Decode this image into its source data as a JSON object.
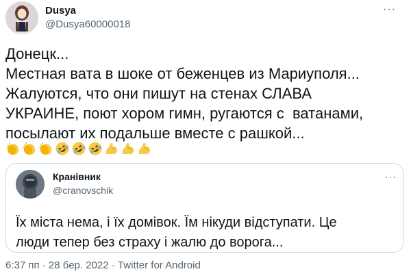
{
  "tweet": {
    "author": {
      "name": "Dusya",
      "handle": "@Dusya60000018",
      "avatar_icon": "doll-avatar"
    },
    "more_label": "···",
    "text": "Донецк...\nМестная вата в шоке от беженцев из Мариуполя...\nЖалуются, что они пишут на стенах СЛАВА\nУКРАИНЕ, поют хором гимн, ругаются с  ватанами,\nпосылают их подальше вместе с рашкой...",
    "emojis": [
      "clapping-hands",
      "clapping-hands",
      "clapping-hands",
      "rolling-laughing",
      "rolling-laughing",
      "rolling-laughing",
      "flexed-biceps",
      "flexed-biceps",
      "flexed-biceps"
    ],
    "quoted": {
      "name": "Кранівник",
      "handle": "@cranovschik",
      "more_label": "···",
      "text": "Їх міста нема, і їх домівок. Їм нікуди відступати. Це\nлюди тепер без страху і жалю до ворога..."
    },
    "timestamp": "6:37 пп · 28 бер. 2022 · Twitter for Android"
  },
  "colors": {
    "text_primary": "#0f1419",
    "text_secondary": "#536471",
    "border": "#cfd9de"
  }
}
